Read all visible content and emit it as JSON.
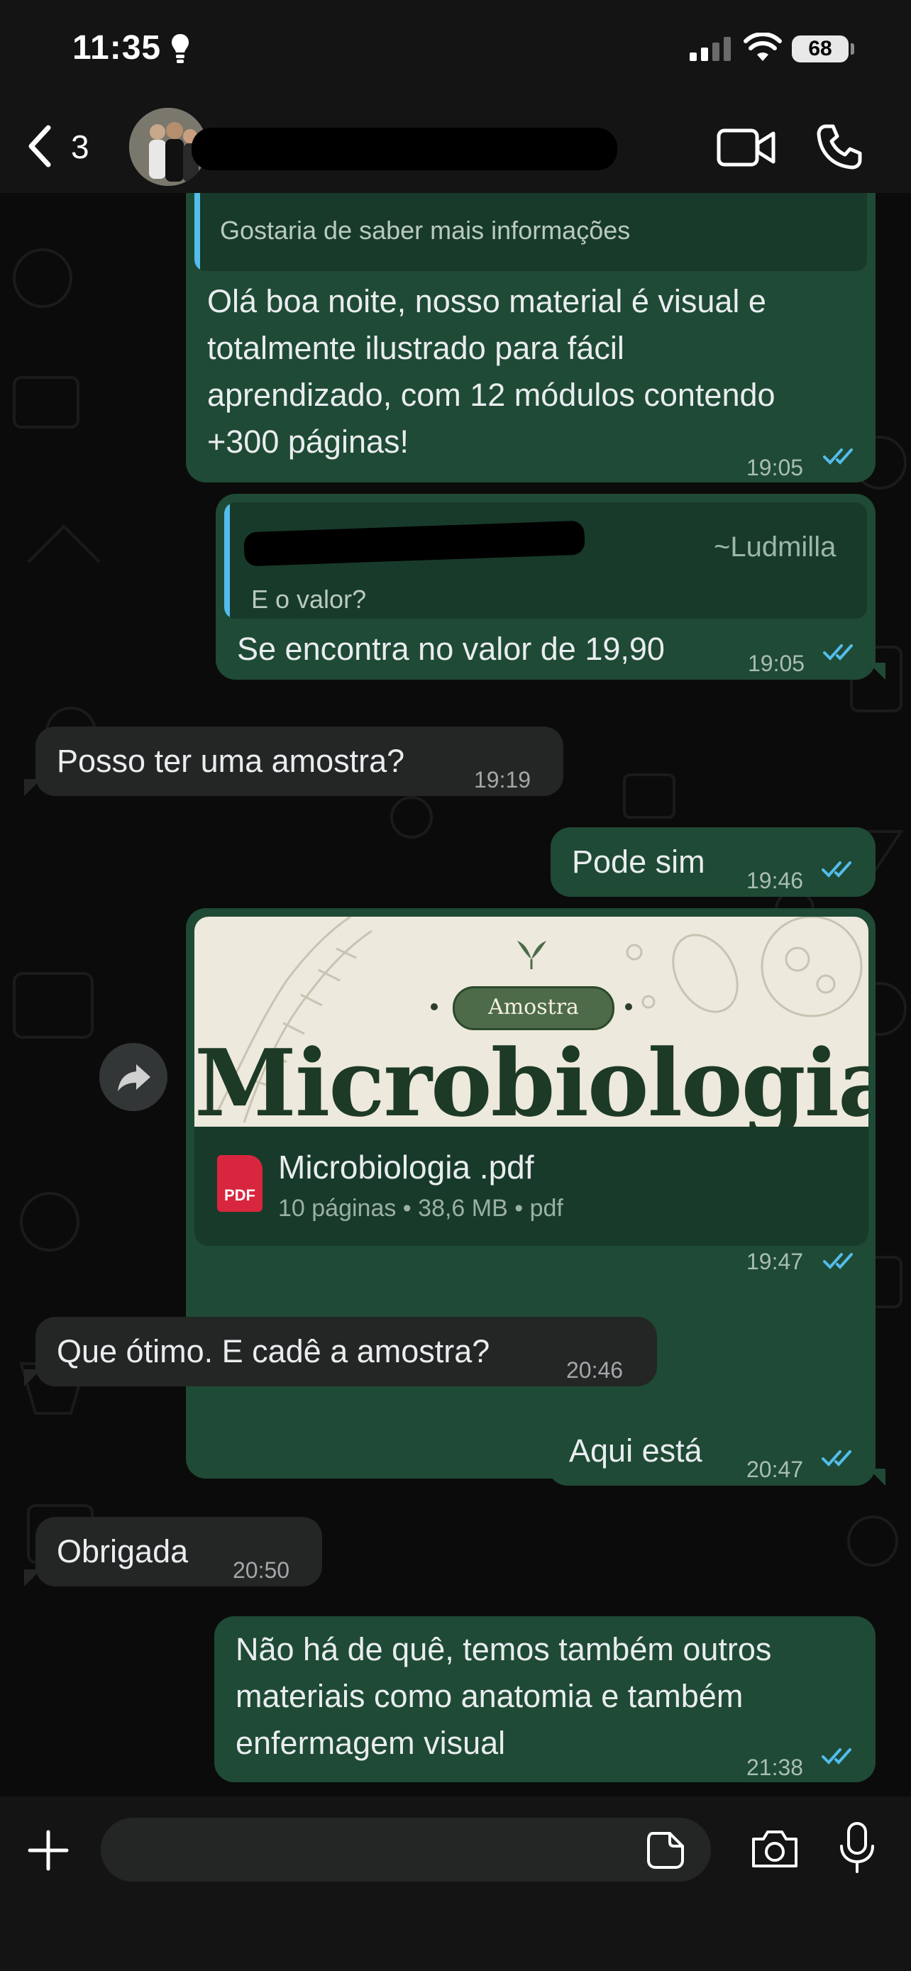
{
  "status": {
    "time": "11:35",
    "battery": "68"
  },
  "header": {
    "back_count": "3"
  },
  "messages": [
    {
      "side": "out",
      "quote_text": "Gostaria de saber mais informações",
      "text_lines": [
        "Olá boa noite, nosso material é visual e",
        "totalmente ilustrado para fácil",
        "aprendizado, com 12 módulos contendo",
        "+300 páginas!"
      ],
      "time": "19:05"
    },
    {
      "side": "out",
      "quote_author": "~Ludmilla",
      "quote_text": "E o valor?",
      "text": "Se encontra no valor de 19,90",
      "time": "19:05"
    },
    {
      "side": "in",
      "text": "Posso ter uma amostra?",
      "time": "19:19"
    },
    {
      "side": "out",
      "text": "Pode sim",
      "time": "19:46"
    },
    {
      "side": "out",
      "attachment": {
        "preview_badge": "Amostra",
        "preview_title": "Microbiologia",
        "file_icon": "PDF",
        "file_name": "Microbiologia .pdf",
        "file_meta": "10 páginas • 38,6 MB • pdf"
      },
      "time": "19:47"
    },
    {
      "side": "in",
      "text": "Que ótimo. E cadê a amostra?",
      "time": "20:46"
    },
    {
      "side": "out",
      "text": "Aqui está",
      "time": "20:47"
    },
    {
      "side": "in",
      "text": "Obrigada",
      "time": "20:50"
    },
    {
      "side": "out",
      "text_lines": [
        "Não há de quê, temos também outros",
        "materiais como anatomia e também",
        "enfermagem visual"
      ],
      "time": "21:38"
    }
  ],
  "composer": {
    "placeholder": ""
  },
  "colors": {
    "outgoing_bubble": "#1f4a35",
    "incoming_bubble": "#242626",
    "read_ticks": "#53bdeb",
    "quote_bar": "#53bdeb"
  },
  "icons": [
    "lightbulb-icon",
    "signal-icon",
    "wifi-icon",
    "battery-icon",
    "back-chevron-icon",
    "video-call-icon",
    "phone-call-icon",
    "forward-icon",
    "pdf-icon",
    "plus-icon",
    "sticker-icon",
    "camera-icon",
    "microphone-icon"
  ]
}
